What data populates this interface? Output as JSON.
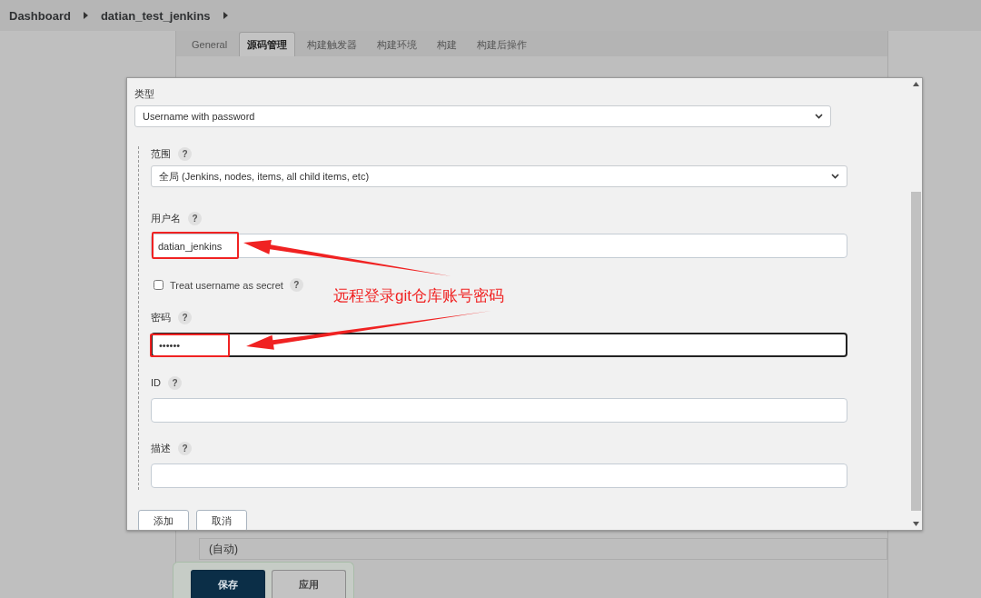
{
  "breadcrumb": [
    {
      "label": "Dashboard"
    },
    {
      "label": "datian_test_jenkins"
    }
  ],
  "tabs": [
    {
      "label": "General",
      "selected": false
    },
    {
      "label": "源码管理",
      "selected": true
    },
    {
      "label": "构建触发器",
      "selected": false
    },
    {
      "label": "构建环境",
      "selected": false
    },
    {
      "label": "构建",
      "selected": false
    },
    {
      "label": "构建后操作",
      "selected": false
    }
  ],
  "background_field": {
    "value": "(自动)"
  },
  "footer_buttons": [
    {
      "label": "保存",
      "kind": "primary"
    },
    {
      "label": "应用",
      "kind": "secondary"
    }
  ],
  "dialog": {
    "type_label": "类型",
    "type_value": "Username with password",
    "fields": [
      {
        "kind": "select",
        "label": "范围",
        "help": "?",
        "value": "全局 (Jenkins, nodes, items, all child items, etc)",
        "focused": false
      },
      {
        "kind": "text",
        "label": "用户名",
        "help": "?",
        "value": "datian_jenkins",
        "focused": false
      },
      {
        "kind": "checkbox",
        "label": "Treat username as secret",
        "help": "?",
        "checked": false
      },
      {
        "kind": "text",
        "label": "密码",
        "help": "?",
        "value": "••••••",
        "focused": true
      },
      {
        "kind": "text",
        "label": "ID",
        "help": "?",
        "focused": false
      },
      {
        "kind": "text",
        "label": "描述",
        "help": "?",
        "focused": false
      }
    ],
    "buttons": [
      "添加",
      "取消"
    ]
  },
  "annotation": {
    "note": "远程登录git仓库账号密码"
  }
}
